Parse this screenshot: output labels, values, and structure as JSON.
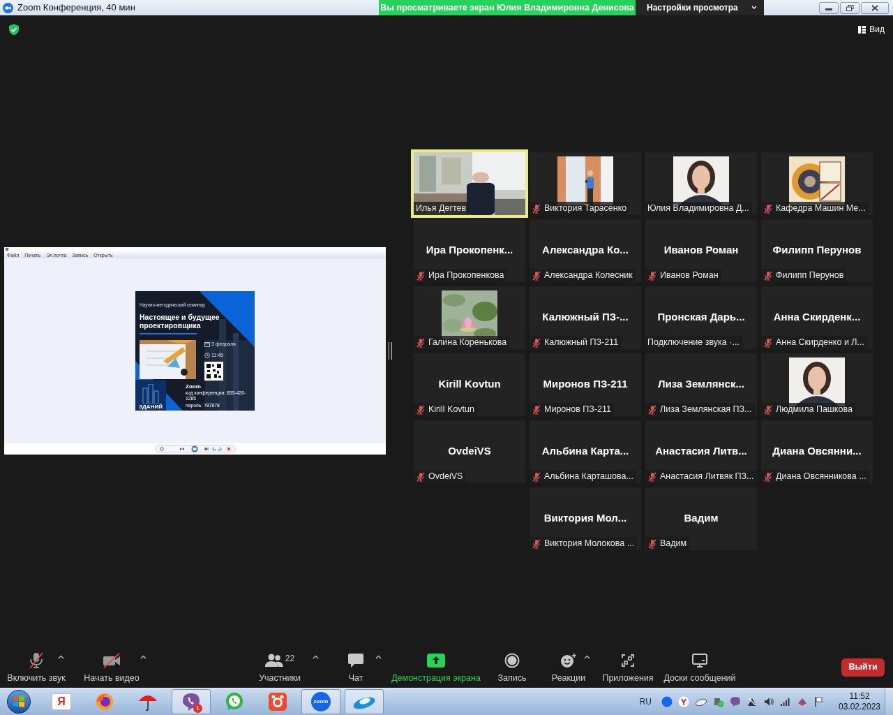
{
  "window": {
    "title": "Zoom Конференция, 40 мин",
    "sharing_banner": "Вы просматриваете экран Юлия Владимировна Денисова",
    "view_options": "Настройки просмотра"
  },
  "view_button": "Вид",
  "shared_screen": {
    "menu": [
      "Файл",
      "Печать",
      "Эл.почта",
      "Запись",
      "Открыть"
    ],
    "poster": {
      "subtitle": "Научно-методический семинар",
      "title": "Настоящее и будущее проектировщика",
      "date": "3 февраля",
      "time": "11:45",
      "platform": "Zoom",
      "conference_code": "код конференции: 655-420-1285",
      "password": "пароль: 787878",
      "logo_text": "ЗДАНИЙ"
    }
  },
  "gallery": [
    [
      {
        "kind": "video",
        "label": "Илья Дегтев",
        "muted": false,
        "speaking": true
      },
      {
        "label": "Виктория Тарасенко",
        "muted": true,
        "speaking": false
      },
      {
        "label": "Юлия Владимировна Д...",
        "muted": false,
        "speaking": false
      },
      {
        "label": "Кафедра Машин Ме...",
        "muted": true,
        "speaking": false
      }
    ],
    [
      {
        "kind": "name",
        "name": "Ира Прокопенк...",
        "label": "Ира Прокопенкова",
        "muted": true,
        "speaking": false
      },
      {
        "kind": "name",
        "name": "Александра Ко...",
        "label": "Александра Колесник",
        "muted": true,
        "speaking": false
      },
      {
        "kind": "name",
        "name": "Иванов Роман",
        "label": "Иванов Роман",
        "muted": true,
        "speaking": false
      },
      {
        "kind": "name",
        "name": "Филипп Перунов",
        "label": "Филипп Перунов",
        "muted": true,
        "speaking": false
      }
    ],
    [
      {
        "label": "Галина Коренькова",
        "muted": true,
        "speaking": false
      },
      {
        "kind": "name",
        "name": "Калюжный ПЗ-...",
        "label": "Калюжный ПЗ-211",
        "muted": true,
        "speaking": false
      },
      {
        "kind": "name",
        "name": "Пронская Дарь...",
        "label": "Подключение звука ·...",
        "muted": false,
        "speaking": false
      },
      {
        "kind": "name",
        "name": "Анна Скирденк...",
        "label": "Анна Скирденко и Л...",
        "muted": true,
        "speaking": false
      }
    ],
    [
      {
        "kind": "name",
        "name": "Kirill Kovtun",
        "label": "Kirill Kovtun",
        "muted": true,
        "speaking": false
      },
      {
        "kind": "name",
        "name": "Миронов ПЗ-211",
        "label": "Миронов ПЗ-211",
        "muted": true,
        "speaking": false
      },
      {
        "kind": "name",
        "name": "Лиза Землянск...",
        "label": "Лиза Землянская ПЗ...",
        "muted": true,
        "speaking": false
      },
      {
        "label": "Людмила Пашкова",
        "muted": true,
        "speaking": false
      }
    ],
    [
      {
        "kind": "name",
        "name": "OvdeiVS",
        "label": "OvdeiVS",
        "muted": true,
        "speaking": false
      },
      {
        "kind": "name",
        "name": "Альбина Карта...",
        "label": "Альбина Карташова...",
        "muted": true,
        "speaking": false
      },
      {
        "kind": "name",
        "name": "Анастасия Литв...",
        "label": "Анастасия Литвяк ПЗ...",
        "muted": true,
        "speaking": false
      },
      {
        "kind": "name",
        "name": "Диана Овсянни...",
        "label": "Диана Овсянникова ...",
        "muted": true,
        "speaking": false
      }
    ],
    [
      {
        "kind": "name",
        "name": "Виктория Мол...",
        "label": "Виктория Молокова ...",
        "muted": true,
        "speaking": false
      },
      {
        "kind": "name",
        "name": "Вадим",
        "label": "Вадим",
        "muted": true,
        "speaking": false
      }
    ]
  ],
  "toolbar": [
    {
      "kind": "mic",
      "label": "Включить звук",
      "has_menu": true
    },
    {
      "kind": "video",
      "label": "Начать видео",
      "has_menu": true
    },
    {
      "kind": "participants",
      "label": "Участники",
      "count": "22",
      "has_menu": true
    },
    {
      "kind": "chat",
      "label": "Чат",
      "has_menu": true
    },
    {
      "kind": "share",
      "label": "Демонстрация экрана",
      "has_menu": false
    },
    {
      "kind": "record",
      "label": "Запись",
      "has_menu": false
    },
    {
      "kind": "reactions",
      "label": "Реакции",
      "has_menu": true
    },
    {
      "kind": "apps",
      "label": "Приложения",
      "has_menu": false
    },
    {
      "kind": "whiteboards",
      "label": "Доски сообщений",
      "has_menu": false
    }
  ],
  "leave_button": "Выйти",
  "taskbar": {
    "apps": [
      {
        "kind": "yandex",
        "label": "Я",
        "selected": false
      },
      {
        "kind": "firefox",
        "selected": false
      },
      {
        "kind": "umbrella",
        "selected": false
      },
      {
        "kind": "viber",
        "badge": "1",
        "selected": true
      },
      {
        "kind": "whatsapp",
        "selected": false
      },
      {
        "kind": "camera",
        "selected": false
      },
      {
        "kind": "zoom",
        "label": "zoom",
        "selected": true
      },
      {
        "kind": "cloud",
        "selected": true
      }
    ],
    "language": "RU",
    "time": "11:52",
    "date": "03.02.2023"
  }
}
